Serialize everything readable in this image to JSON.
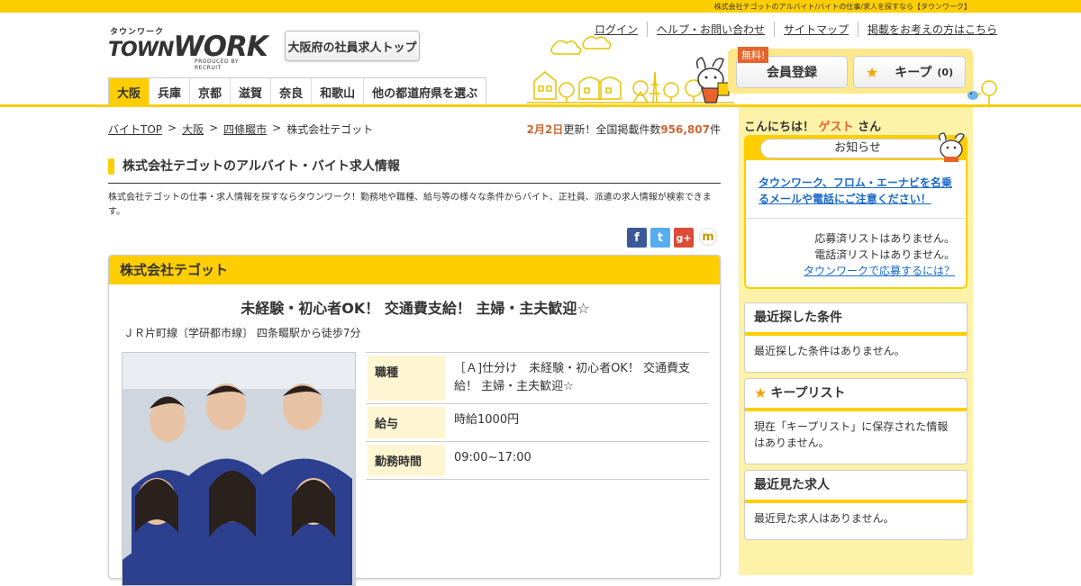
{
  "topbar": {
    "tagline": "株式会社テゴットのアルバイト/バイトの仕事/求人を探すなら【タウンワーク】"
  },
  "logo": {
    "kana": "タウンワーク",
    "main_town": "TOWN",
    "main_work": "WORK",
    "sub": "PRODUCED BY RECRUIT"
  },
  "region_top_button": "大阪府の社員求人トップ",
  "top_links": [
    "ログイン",
    "ヘルプ・お問い合わせ",
    "サイトマップ",
    "掲載をお考えの方はこちら"
  ],
  "member": {
    "free_badge": "無料!",
    "register": "会員登録",
    "keep": "キープ",
    "keep_count": "(0)"
  },
  "nav_tabs": [
    "大阪",
    "兵庫",
    "京都",
    "滋賀",
    "奈良",
    "和歌山",
    "他の都道府県を選ぶ"
  ],
  "breadcrumb": {
    "items": [
      "バイトTOP",
      "大阪",
      "四條畷市",
      "株式会社テゴット"
    ],
    "sep": ">"
  },
  "update": {
    "date": "2月2日",
    "text1": "更新！全国掲載件数",
    "count": "956,807",
    "unit": "件"
  },
  "page": {
    "title": "株式会社テゴットのアルバイト・バイト求人情報",
    "description": "株式会社テゴットの仕事・求人情報を探すならタウンワーク！勤務地や職種、給与等の様々な条件からバイト、正社員、派遣の求人情報が検索できます。"
  },
  "social": {
    "fb": "f",
    "tw": "t",
    "gp": "g+",
    "mx": "m"
  },
  "job": {
    "company": "株式会社テゴット",
    "headline": "未経験・初心者OK！ 交通費支給！ 主婦・主夫歓迎☆",
    "access": "ＪＲ片町線〔学研都市線〕 四条畷駅から徒歩7分",
    "rows": [
      {
        "label": "職種",
        "value": "［Ａ]仕分け　未経験・初心者OK！ 交通費支給！ 主婦・主夫歓迎☆"
      },
      {
        "label": "給与",
        "value": "時給1000円"
      },
      {
        "label": "勤務時間",
        "value": "09:00~17:00"
      }
    ]
  },
  "sidebar": {
    "hello_prefix": "こんにちは！",
    "guest": "ゲスト",
    "hello_suffix": "さん",
    "notice_title": "お知らせ",
    "notice_link": "タウンワーク、フロム・エーナビを名乗るメールや電話にご注意ください！",
    "notice_line1": "応募済リストはありません。",
    "notice_line2": "電話済リストはありません。",
    "notice_link2": "タウンワークで応募するには？",
    "recent_search_title": "最近探した条件",
    "recent_search_body": "最近探した条件はありません。",
    "keep_list_title": "キープリスト",
    "keep_list_body": "現在「キープリスト」に保存された情報はありません。",
    "recent_view_title": "最近見た求人",
    "recent_view_body": "最近見た求人はありません。"
  },
  "colors": {
    "accent": "#fece00",
    "sidebar_bg": "#fdf2a8",
    "orange": "#e8632b",
    "link": "#1a6ac8"
  }
}
